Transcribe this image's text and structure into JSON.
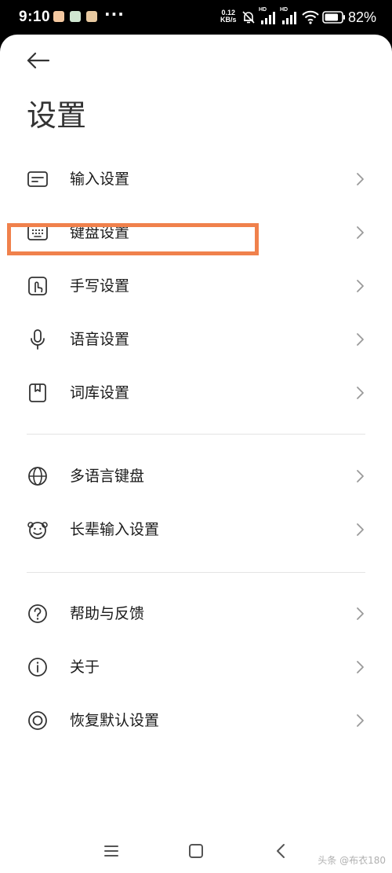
{
  "status_bar": {
    "time": "9:10",
    "more": "···",
    "net_speed_value": "0.12",
    "net_speed_unit": "KB/s",
    "signal_1_label": "HD",
    "signal_2_label": "HD",
    "battery": "82%"
  },
  "header": {
    "title": "设置"
  },
  "groups": [
    {
      "items": [
        {
          "label": "输入设置",
          "icon": "input-settings-icon"
        },
        {
          "label": "键盘设置",
          "icon": "keyboard-icon"
        },
        {
          "label": "手写设置",
          "icon": "handwriting-icon"
        },
        {
          "label": "语音设置",
          "icon": "microphone-icon"
        },
        {
          "label": "词库设置",
          "icon": "dictionary-icon"
        }
      ]
    },
    {
      "items": [
        {
          "label": "多语言键盘",
          "icon": "globe-icon"
        },
        {
          "label": "长辈输入设置",
          "icon": "elder-face-icon"
        }
      ]
    },
    {
      "items": [
        {
          "label": "帮助与反馈",
          "icon": "help-icon"
        },
        {
          "label": "关于",
          "icon": "info-icon"
        },
        {
          "label": "恢复默认设置",
          "icon": "restore-icon"
        }
      ]
    }
  ],
  "highlight": {
    "target": "键盘设置",
    "color": "#f0814c"
  },
  "watermark": "头条 @布衣180",
  "colors": {
    "text": "#1a1a1a",
    "icon": "#333333",
    "chevron": "#9a9a9a",
    "divider": "#e4e4e4"
  }
}
